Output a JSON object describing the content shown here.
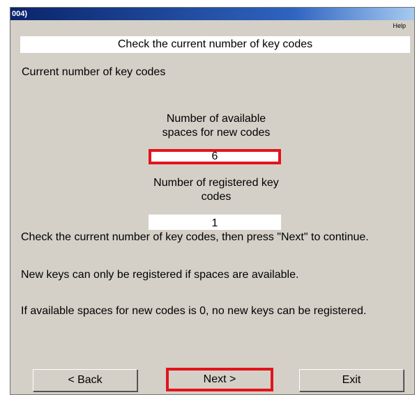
{
  "window": {
    "title": "004)"
  },
  "menu": {
    "help": "Help"
  },
  "header": {
    "title": "Check the current number of key codes"
  },
  "content": {
    "section_label": "Current number of key codes",
    "available_label": "Number of available spaces for new codes",
    "available_value": "6",
    "registered_label": "Number of registered key codes",
    "registered_value": "1",
    "instruction_1": "Check the current number of key codes, then press \"Next\" to continue.",
    "instruction_2": "New keys can only be registered if spaces are available.",
    "instruction_3": "If available spaces for new codes is 0, no new keys can be registered."
  },
  "buttons": {
    "back": "< Back",
    "next": "Next >",
    "exit": "Exit"
  },
  "colors": {
    "dialog_background": "#d4d0c8",
    "highlight_red": "#e2141b",
    "titlebar": "#0a246a"
  }
}
